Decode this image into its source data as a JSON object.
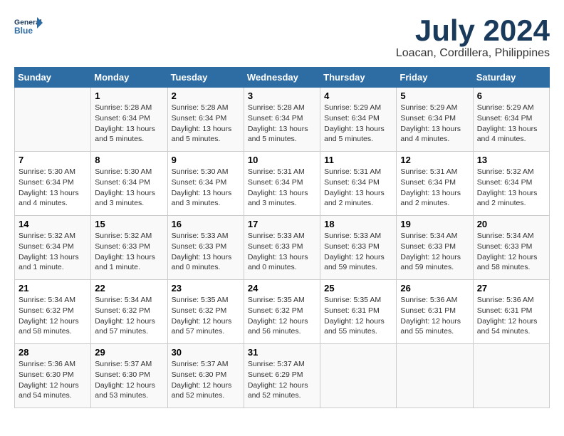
{
  "header": {
    "logo_line1": "General",
    "logo_line2": "Blue",
    "month_year": "July 2024",
    "location": "Loacan, Cordillera, Philippines"
  },
  "weekdays": [
    "Sunday",
    "Monday",
    "Tuesday",
    "Wednesday",
    "Thursday",
    "Friday",
    "Saturday"
  ],
  "weeks": [
    [
      {
        "day": "",
        "info": ""
      },
      {
        "day": "1",
        "info": "Sunrise: 5:28 AM\nSunset: 6:34 PM\nDaylight: 13 hours\nand 5 minutes."
      },
      {
        "day": "2",
        "info": "Sunrise: 5:28 AM\nSunset: 6:34 PM\nDaylight: 13 hours\nand 5 minutes."
      },
      {
        "day": "3",
        "info": "Sunrise: 5:28 AM\nSunset: 6:34 PM\nDaylight: 13 hours\nand 5 minutes."
      },
      {
        "day": "4",
        "info": "Sunrise: 5:29 AM\nSunset: 6:34 PM\nDaylight: 13 hours\nand 5 minutes."
      },
      {
        "day": "5",
        "info": "Sunrise: 5:29 AM\nSunset: 6:34 PM\nDaylight: 13 hours\nand 4 minutes."
      },
      {
        "day": "6",
        "info": "Sunrise: 5:29 AM\nSunset: 6:34 PM\nDaylight: 13 hours\nand 4 minutes."
      }
    ],
    [
      {
        "day": "7",
        "info": "Sunrise: 5:30 AM\nSunset: 6:34 PM\nDaylight: 13 hours\nand 4 minutes."
      },
      {
        "day": "8",
        "info": "Sunrise: 5:30 AM\nSunset: 6:34 PM\nDaylight: 13 hours\nand 3 minutes."
      },
      {
        "day": "9",
        "info": "Sunrise: 5:30 AM\nSunset: 6:34 PM\nDaylight: 13 hours\nand 3 minutes."
      },
      {
        "day": "10",
        "info": "Sunrise: 5:31 AM\nSunset: 6:34 PM\nDaylight: 13 hours\nand 3 minutes."
      },
      {
        "day": "11",
        "info": "Sunrise: 5:31 AM\nSunset: 6:34 PM\nDaylight: 13 hours\nand 2 minutes."
      },
      {
        "day": "12",
        "info": "Sunrise: 5:31 AM\nSunset: 6:34 PM\nDaylight: 13 hours\nand 2 minutes."
      },
      {
        "day": "13",
        "info": "Sunrise: 5:32 AM\nSunset: 6:34 PM\nDaylight: 13 hours\nand 2 minutes."
      }
    ],
    [
      {
        "day": "14",
        "info": "Sunrise: 5:32 AM\nSunset: 6:34 PM\nDaylight: 13 hours\nand 1 minute."
      },
      {
        "day": "15",
        "info": "Sunrise: 5:32 AM\nSunset: 6:33 PM\nDaylight: 13 hours\nand 1 minute."
      },
      {
        "day": "16",
        "info": "Sunrise: 5:33 AM\nSunset: 6:33 PM\nDaylight: 13 hours\nand 0 minutes."
      },
      {
        "day": "17",
        "info": "Sunrise: 5:33 AM\nSunset: 6:33 PM\nDaylight: 13 hours\nand 0 minutes."
      },
      {
        "day": "18",
        "info": "Sunrise: 5:33 AM\nSunset: 6:33 PM\nDaylight: 12 hours\nand 59 minutes."
      },
      {
        "day": "19",
        "info": "Sunrise: 5:34 AM\nSunset: 6:33 PM\nDaylight: 12 hours\nand 59 minutes."
      },
      {
        "day": "20",
        "info": "Sunrise: 5:34 AM\nSunset: 6:33 PM\nDaylight: 12 hours\nand 58 minutes."
      }
    ],
    [
      {
        "day": "21",
        "info": "Sunrise: 5:34 AM\nSunset: 6:32 PM\nDaylight: 12 hours\nand 58 minutes."
      },
      {
        "day": "22",
        "info": "Sunrise: 5:34 AM\nSunset: 6:32 PM\nDaylight: 12 hours\nand 57 minutes."
      },
      {
        "day": "23",
        "info": "Sunrise: 5:35 AM\nSunset: 6:32 PM\nDaylight: 12 hours\nand 57 minutes."
      },
      {
        "day": "24",
        "info": "Sunrise: 5:35 AM\nSunset: 6:32 PM\nDaylight: 12 hours\nand 56 minutes."
      },
      {
        "day": "25",
        "info": "Sunrise: 5:35 AM\nSunset: 6:31 PM\nDaylight: 12 hours\nand 55 minutes."
      },
      {
        "day": "26",
        "info": "Sunrise: 5:36 AM\nSunset: 6:31 PM\nDaylight: 12 hours\nand 55 minutes."
      },
      {
        "day": "27",
        "info": "Sunrise: 5:36 AM\nSunset: 6:31 PM\nDaylight: 12 hours\nand 54 minutes."
      }
    ],
    [
      {
        "day": "28",
        "info": "Sunrise: 5:36 AM\nSunset: 6:30 PM\nDaylight: 12 hours\nand 54 minutes."
      },
      {
        "day": "29",
        "info": "Sunrise: 5:37 AM\nSunset: 6:30 PM\nDaylight: 12 hours\nand 53 minutes."
      },
      {
        "day": "30",
        "info": "Sunrise: 5:37 AM\nSunset: 6:30 PM\nDaylight: 12 hours\nand 52 minutes."
      },
      {
        "day": "31",
        "info": "Sunrise: 5:37 AM\nSunset: 6:29 PM\nDaylight: 12 hours\nand 52 minutes."
      },
      {
        "day": "",
        "info": ""
      },
      {
        "day": "",
        "info": ""
      },
      {
        "day": "",
        "info": ""
      }
    ]
  ]
}
